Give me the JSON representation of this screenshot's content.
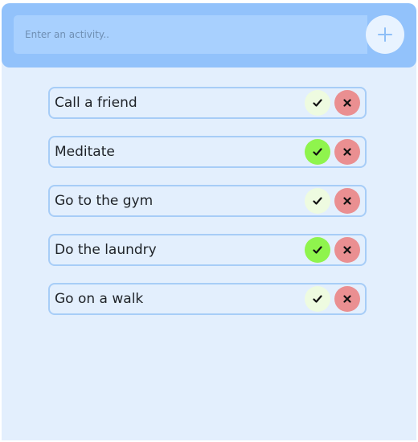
{
  "header": {
    "search": {
      "placeholder": "Enter an activity..",
      "value": ""
    },
    "add_button_icon": "plus-icon"
  },
  "tasks": [
    {
      "label": "Call a friend",
      "completed": false
    },
    {
      "label": "Meditate",
      "completed": true
    },
    {
      "label": "Go to the gym",
      "completed": false
    },
    {
      "label": "Do the laundry",
      "completed": true
    },
    {
      "label": "Go on a walk",
      "completed": false
    }
  ],
  "icons": {
    "complete": "check-icon",
    "delete": "close-icon"
  },
  "colors": {
    "header": "#92c2fb",
    "background": "#e3effd",
    "item_border": "#a7cdf7",
    "check_inactive": "#eefbe0",
    "check_active": "#8ff44d",
    "delete": "#ea8f91"
  }
}
